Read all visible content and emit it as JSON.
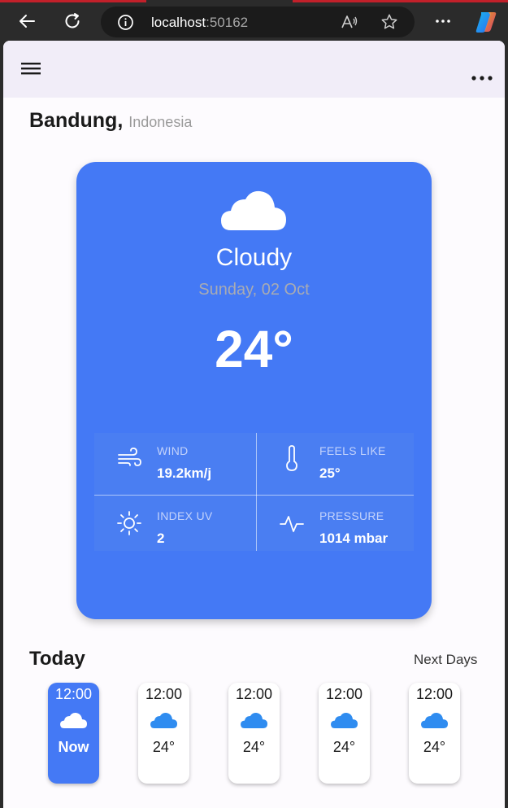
{
  "browser": {
    "url_host": "localhost",
    "url_port": ":50162"
  },
  "location": {
    "city": "Bandung,",
    "country": "Indonesia"
  },
  "current": {
    "condition": "Cloudy",
    "date": "Sunday, 02 Oct",
    "temperature": "24°",
    "icon": "cloud-icon"
  },
  "stats": [
    {
      "label": "WIND",
      "value": "19.2km/j",
      "icon": "wind-icon"
    },
    {
      "label": "FEELS LIKE",
      "value": "25°",
      "icon": "thermometer-icon"
    },
    {
      "label": "INDEX UV",
      "value": "2",
      "icon": "sun-icon"
    },
    {
      "label": "PRESSURE",
      "value": "1014 mbar",
      "icon": "pulse-icon"
    }
  ],
  "forecast": {
    "title": "Today",
    "next_label": "Next Days",
    "hours": [
      {
        "time": "12:00",
        "temp": "Now",
        "active": true
      },
      {
        "time": "12:00",
        "temp": "24°",
        "active": false
      },
      {
        "time": "12:00",
        "temp": "24°",
        "active": false
      },
      {
        "time": "12:00",
        "temp": "24°",
        "active": false
      },
      {
        "time": "12:00",
        "temp": "24°",
        "active": false
      }
    ]
  },
  "colors": {
    "accent": "#4479f5",
    "hour_cloud": "#2f8cf0"
  }
}
